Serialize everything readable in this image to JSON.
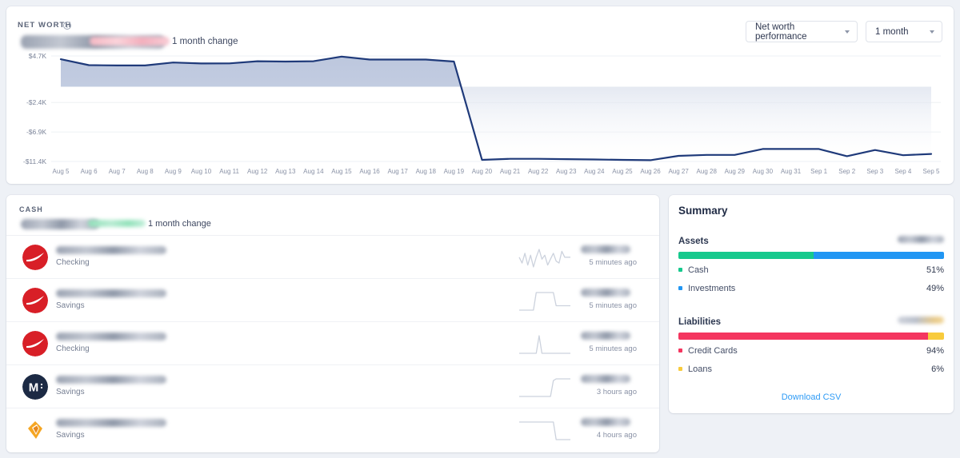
{
  "net_worth": {
    "label": "NET WORTH",
    "info_icon": "info-icon",
    "change_caption": "1 month change",
    "amount_redacted": true,
    "change_redacted": true,
    "performance_select": "Net worth performance",
    "range_select": "1 month"
  },
  "chart_data": {
    "type": "area",
    "title": "Net worth performance",
    "xlabel": "",
    "ylabel": "",
    "ylim": [
      -11400,
      4700
    ],
    "grid": true,
    "legend": "none",
    "ytick_labels": [
      "$4.7K",
      "-$2.4K",
      "-$6.9K",
      "-$11.4K"
    ],
    "ytick_values": [
      4700,
      -2400,
      -6900,
      -11400
    ],
    "categories": [
      "Aug 5",
      "Aug 6",
      "Aug 7",
      "Aug 8",
      "Aug 9",
      "Aug 10",
      "Aug 11",
      "Aug 12",
      "Aug 13",
      "Aug 14",
      "Aug 15",
      "Aug 16",
      "Aug 17",
      "Aug 18",
      "Aug 19",
      "Aug 20",
      "Aug 21",
      "Aug 22",
      "Aug 23",
      "Aug 24",
      "Aug 25",
      "Aug 26",
      "Aug 27",
      "Aug 28",
      "Aug 29",
      "Aug 30",
      "Aug 31",
      "Sep 1",
      "Sep 2",
      "Sep 3",
      "Sep 4",
      "Sep 5"
    ],
    "values": [
      4200,
      3300,
      3250,
      3250,
      3700,
      3550,
      3560,
      3900,
      3850,
      3900,
      4600,
      4150,
      4150,
      4150,
      3850,
      -11150,
      -11000,
      -11000,
      -11050,
      -11100,
      -11150,
      -11200,
      -10550,
      -10400,
      -10400,
      -9500,
      -9500,
      -9500,
      -10600,
      -9650,
      -10450,
      -10250
    ],
    "line_color": "#1f3a7a",
    "fill_color": "#b9c4dc"
  },
  "cash": {
    "label": "CASH",
    "change_caption": "1 month change",
    "amount_redacted": true,
    "change_redacted": true,
    "accounts": [
      {
        "icon": "red-swoosh-logo-icon",
        "icon_color": "#d81f27",
        "name_redacted": true,
        "type": "Checking",
        "balance_redacted": true,
        "updated": "5 minutes ago",
        "sparkline": [
          12,
          9,
          14,
          8,
          13,
          7,
          12,
          16,
          11,
          13,
          8,
          11,
          14,
          10,
          9,
          15,
          12,
          12,
          12
        ]
      },
      {
        "icon": "red-swoosh-logo-icon",
        "icon_color": "#d81f27",
        "name_redacted": true,
        "type": "Savings",
        "balance_redacted": true,
        "updated": "5 minutes ago",
        "sparkline": [
          6,
          6,
          6,
          6,
          6,
          6,
          14,
          14,
          14,
          14,
          14,
          14,
          14,
          8,
          8,
          8,
          8,
          8,
          8
        ]
      },
      {
        "icon": "red-swoosh-logo-icon",
        "icon_color": "#d81f27",
        "name_redacted": true,
        "type": "Checking",
        "balance_redacted": true,
        "updated": "5 minutes ago",
        "sparkline": [
          7,
          7,
          7,
          7,
          7,
          7,
          7,
          18,
          7,
          7,
          7,
          7,
          7,
          7,
          7,
          7,
          7,
          7,
          7
        ]
      },
      {
        "icon": "m-monogram-icon",
        "icon_color": "#1c2a44",
        "name_redacted": true,
        "type": "Savings",
        "balance_redacted": true,
        "updated": "3 hours ago",
        "sparkline": [
          6,
          6,
          6,
          6,
          6,
          6,
          6,
          6,
          6,
          6,
          6,
          6,
          15,
          16,
          16,
          16,
          16,
          16,
          16
        ]
      },
      {
        "icon": "gold-diamond-logo-icon",
        "icon_color": "#f5a623",
        "name_redacted": true,
        "type": "Savings",
        "balance_redacted": true,
        "updated": "4 hours ago",
        "sparkline": [
          14,
          14,
          14,
          14,
          14,
          14,
          14,
          14,
          14,
          14,
          14,
          14,
          14,
          6,
          6,
          6,
          6,
          6,
          6
        ]
      }
    ]
  },
  "summary": {
    "title": "Summary",
    "sections": [
      {
        "name": "Assets",
        "total_redacted": true,
        "items": [
          {
            "label": "Cash",
            "pct": "51%",
            "value": 51,
            "color": "#16c98d"
          },
          {
            "label": "Investments",
            "pct": "49%",
            "value": 49,
            "color": "#2196f3"
          }
        ]
      },
      {
        "name": "Liabilities",
        "total_redacted": true,
        "items": [
          {
            "label": "Credit Cards",
            "pct": "94%",
            "value": 94,
            "color": "#f4365f"
          },
          {
            "label": "Loans",
            "pct": "6%",
            "value": 6,
            "color": "#f8cb3c"
          }
        ]
      }
    ],
    "download_label": "Download CSV"
  }
}
